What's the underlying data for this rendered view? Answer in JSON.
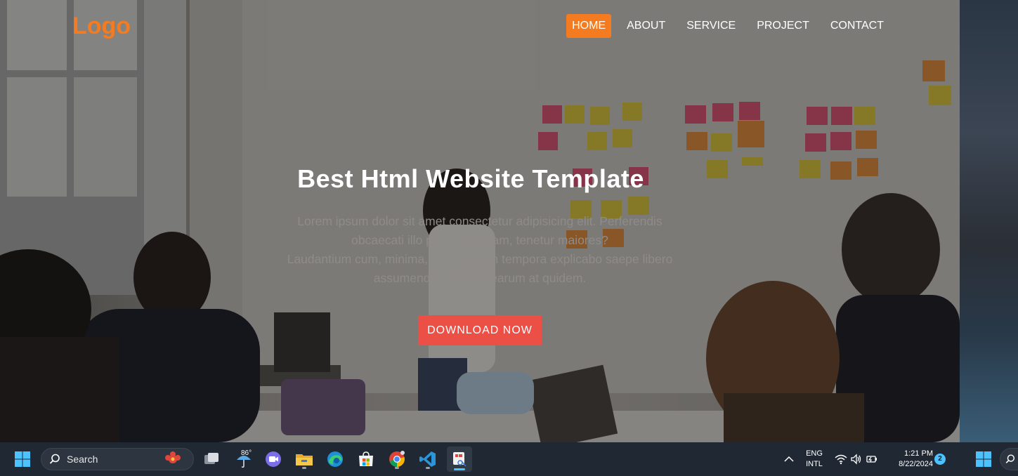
{
  "site": {
    "logo": "Logo",
    "nav": [
      {
        "label": "HOME",
        "active": true
      },
      {
        "label": "ABOUT",
        "active": false
      },
      {
        "label": "SERVICE",
        "active": false
      },
      {
        "label": "PROJECT",
        "active": false
      },
      {
        "label": "CONTACT",
        "active": false
      }
    ],
    "headline": "Best Html Website Template",
    "lead_lines": [
      "Lorem ipsum dolor sit amet consectetur adipisicing elit. Perferendis",
      "obcaecati illo porro! Magnam, tenetur maiores?",
      "Laudantium cum, minima, et vel autem tempora explicabo saepe libero",
      "assumenda expedita earum at quidem."
    ],
    "cta_label": "DOWNLOAD NOW",
    "colors": {
      "accent": "#f47b20",
      "cta": "#eb4f45"
    }
  },
  "taskbar": {
    "search_label": "Search",
    "weather_temp": "86°",
    "apps": [
      {
        "icon": "task-view-icon",
        "active": false
      },
      {
        "icon": "weather-icon",
        "active": false
      },
      {
        "icon": "meet-chat-icon",
        "active": false
      },
      {
        "icon": "file-explorer-icon",
        "active": false
      },
      {
        "icon": "edge-browser-icon",
        "active": false
      },
      {
        "icon": "microsoft-store-icon",
        "active": false
      },
      {
        "icon": "chrome-browser-icon",
        "active": false
      },
      {
        "icon": "vscode-icon",
        "active": false
      },
      {
        "icon": "snipping-tool-icon",
        "active": true
      }
    ],
    "language": {
      "line1": "ENG",
      "line2": "INTL"
    },
    "clock": {
      "time": "1:21 PM",
      "date": "8/22/2024"
    },
    "notification_count": "2"
  }
}
